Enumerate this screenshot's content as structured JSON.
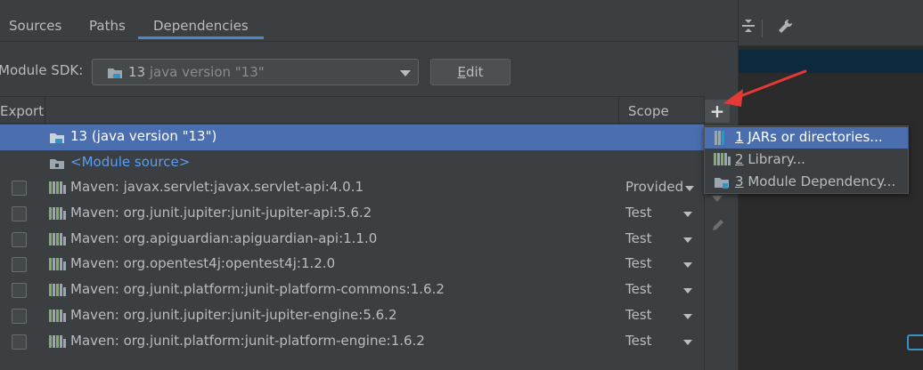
{
  "tabs": [
    "Sources",
    "Paths",
    "Dependencies"
  ],
  "sdk": {
    "label": "Module SDK:",
    "value_main": "13",
    "value_detail": "java version \"13\"",
    "edit_mnemonic": "E",
    "edit_rest": "dit"
  },
  "table": {
    "col_export": "Export",
    "col_scope": "Scope",
    "rows": [
      {
        "name": "13 (java version \"13\")",
        "scope": ""
      },
      {
        "name": "<Module source>",
        "scope": ""
      },
      {
        "name": "Maven: javax.servlet:javax.servlet-api:4.0.1",
        "scope": "Provided"
      },
      {
        "name": "Maven: org.junit.jupiter:junit-jupiter-api:5.6.2",
        "scope": "Test"
      },
      {
        "name": "Maven: org.apiguardian:apiguardian-api:1.1.0",
        "scope": "Test"
      },
      {
        "name": "Maven: org.opentest4j:opentest4j:1.2.0",
        "scope": "Test"
      },
      {
        "name": "Maven: org.junit.platform:junit-platform-commons:1.6.2",
        "scope": "Test"
      },
      {
        "name": "Maven: org.junit.jupiter:junit-jupiter-engine:5.6.2",
        "scope": "Test"
      },
      {
        "name": "Maven: org.junit.platform:junit-platform-engine:1.6.2",
        "scope": "Test"
      }
    ]
  },
  "toolbar": {
    "add_label": "+"
  },
  "popup": {
    "items": [
      {
        "num": "1",
        "label": "JARs or directories..."
      },
      {
        "num": "2",
        "label": "Library..."
      },
      {
        "num": "3",
        "label": "Module Dependency..."
      }
    ]
  },
  "colors": {
    "selection": "#4b6eaf",
    "background": "#3c3f41",
    "link": "#589df6",
    "annotation_arrow": "#e53935"
  }
}
